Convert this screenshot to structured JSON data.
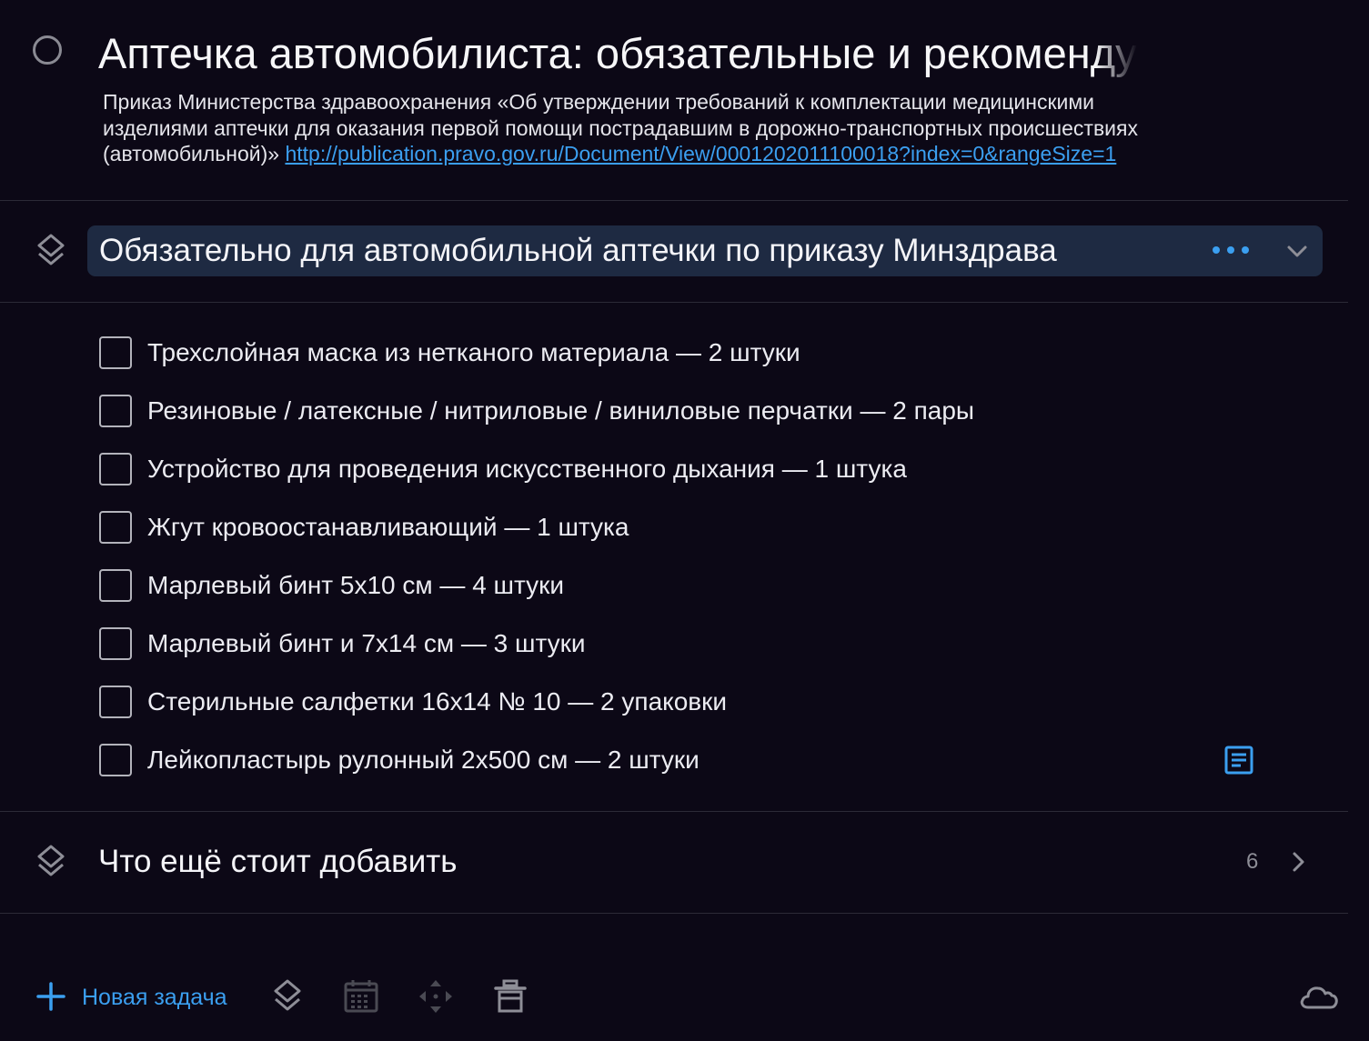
{
  "task": {
    "title": "Аптечка автомобилиста: обязательные и рекомендуемые",
    "notes_line1": "Приказ Министерства здравоохранения «Об утверждении требований к комплектации медицинскими",
    "notes_line2": "изделиями аптечки для оказания первой помощи пострадавшим в дорожно-транспортных происшествиях",
    "notes_line3_prefix": "(автомобильной)» ",
    "notes_link": "http://publication.pravo.gov.ru/Document/View/0001202011100018?index=0&rangeSize=1"
  },
  "heading1": {
    "title": "Обязательно для автомобильной аптечки по приказу Минздрава",
    "icons": [
      "heading-icon",
      "more-icon",
      "chevron-down-icon"
    ]
  },
  "checklist": [
    {
      "label": "Трехслойная маска из нетканого материала — 2 штуки",
      "checked": false
    },
    {
      "label": "Резиновые / латексные / нитриловые / виниловые перчатки — 2 пары",
      "checked": false
    },
    {
      "label": "Устройство для проведения искусственного дыхания — 1 штука",
      "checked": false
    },
    {
      "label": "Жгут кровоостанавливающий — 1 штука",
      "checked": false
    },
    {
      "label": "Марлевый бинт 5х10 см — 4 штуки",
      "checked": false
    },
    {
      "label": "Марлевый бинт и 7х14 см — 3 штуки",
      "checked": false
    },
    {
      "label": "Стерильные салфетки 16х14 № 10 — 2 упаковки",
      "checked": false
    },
    {
      "label": "Лейкопластырь рулонный 2х500 см — 2 штуки",
      "checked": false,
      "has_note": true
    }
  ],
  "heading2": {
    "title": "Что ещё стоит добавить",
    "count": "6"
  },
  "toolbar": {
    "new_task_label": "Новая задача",
    "icons": [
      "plus-icon",
      "heading-icon",
      "calendar-icon",
      "move-icon",
      "trash-icon",
      "cloud-icon"
    ]
  },
  "colors": {
    "background": "#0c0816",
    "accent": "#3b9ff0",
    "heading_highlight": "#1e2a42"
  }
}
